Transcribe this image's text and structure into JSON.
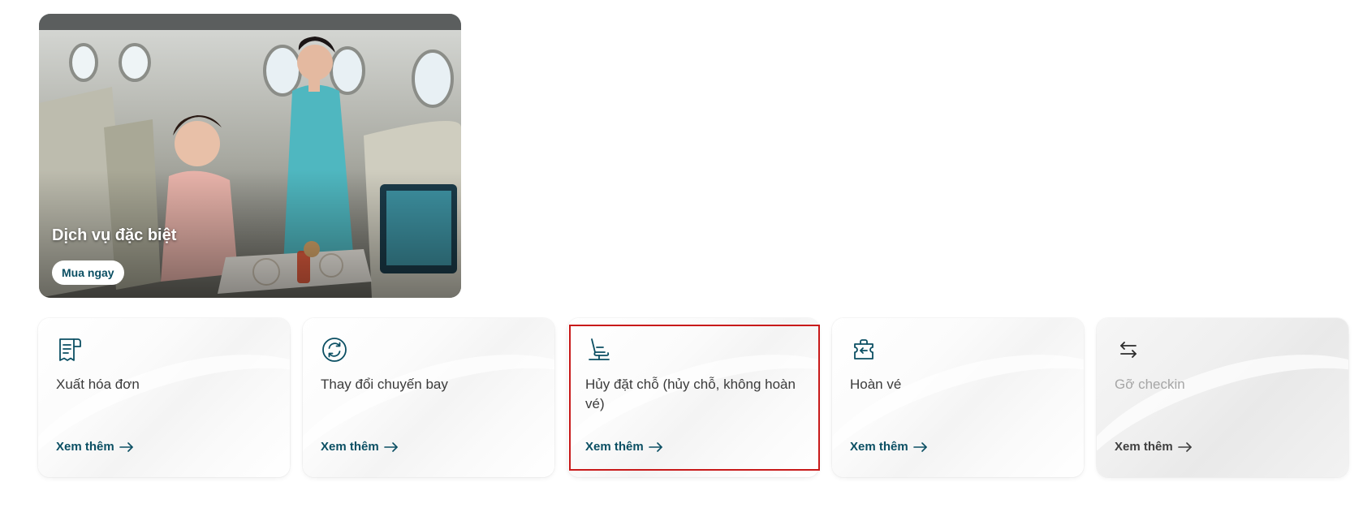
{
  "promo": {
    "title": "Dịch vụ đặc biệt",
    "button_label": "Mua ngay"
  },
  "cards": [
    {
      "title": "Xuất hóa đơn",
      "link_label": "Xem thêm",
      "icon": "receipt-icon",
      "disabled": false
    },
    {
      "title": "Thay đổi chuyến bay",
      "link_label": "Xem thêm",
      "icon": "refresh-icon",
      "disabled": false
    },
    {
      "title": "Hủy đặt chỗ (hủy chỗ, không hoàn vé)",
      "link_label": "Xem thêm",
      "icon": "seat-icon",
      "disabled": false
    },
    {
      "title": "Hoàn vé",
      "link_label": "Xem thêm",
      "icon": "ticket-refund-icon",
      "disabled": false
    },
    {
      "title": "Gỡ checkin",
      "link_label": "Xem thêm",
      "icon": "swap-arrows-icon",
      "disabled": true
    }
  ],
  "colors": {
    "accent": "#0b4f63",
    "highlight": "#c81a1a",
    "disabled_text": "#a6a6a6"
  }
}
